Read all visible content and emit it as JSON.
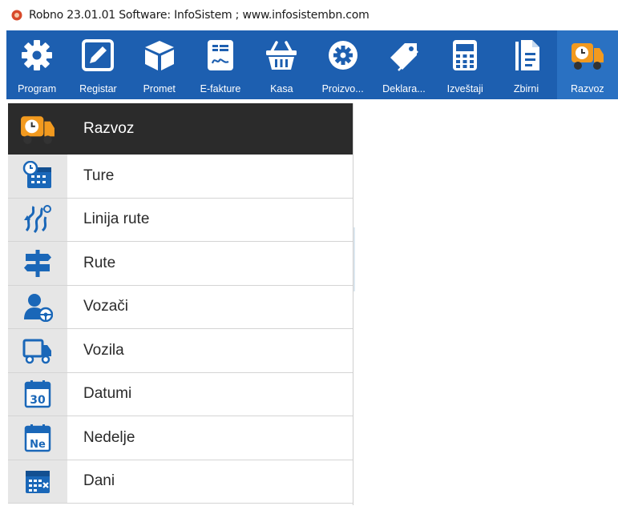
{
  "window": {
    "title": "Robno  23.01.01  Software: InfoSistem ;  www.infosistembn.com"
  },
  "toolbar": {
    "items": [
      {
        "label": "Program",
        "icon": "gear-icon"
      },
      {
        "label": "Registar",
        "icon": "edit-icon"
      },
      {
        "label": "Promet",
        "icon": "box-icon"
      },
      {
        "label": "E-fakture",
        "icon": "e-invoice-icon"
      },
      {
        "label": "Kasa",
        "icon": "basket-icon"
      },
      {
        "label": "Proizvo...",
        "icon": "production-gear-icon"
      },
      {
        "label": "Deklara...",
        "icon": "tag-icon"
      },
      {
        "label": "Izveštaji",
        "icon": "calculator-icon"
      },
      {
        "label": "Zbirni",
        "icon": "document-icon"
      },
      {
        "label": "Razvoz",
        "icon": "delivery-truck-icon"
      }
    ],
    "active": "Razvoz"
  },
  "menu": {
    "header": "Razvoz",
    "items": [
      {
        "label": "Ture",
        "icon": "schedule-icon"
      },
      {
        "label": "Linija rute",
        "icon": "route-line-icon"
      },
      {
        "label": "Rute",
        "icon": "signpost-icon"
      },
      {
        "label": "Vozači",
        "icon": "driver-icon"
      },
      {
        "label": "Vozila",
        "icon": "truck-icon"
      },
      {
        "label": "Datumi",
        "icon": "calendar-30-icon"
      },
      {
        "label": "Nedelje",
        "icon": "calendar-ne-icon"
      },
      {
        "label": "Dani",
        "icon": "calendar-grid-icon"
      }
    ]
  },
  "colors": {
    "toolbar_bg": "#1d5fb0",
    "header_bg": "#2b2b2b",
    "icon_blue": "#1a67b8",
    "accent_orange": "#f29a1f"
  },
  "calendar_numbers": {
    "datumi": "30",
    "nedelje": "Ne"
  }
}
